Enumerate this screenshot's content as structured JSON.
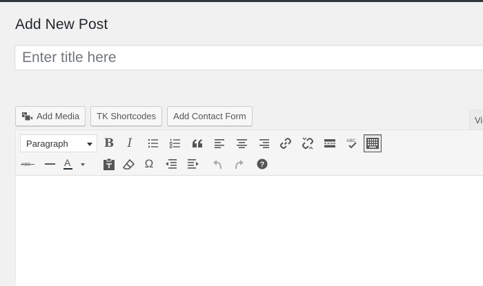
{
  "page": {
    "title": "Add New Post"
  },
  "title_field": {
    "placeholder": "Enter title here",
    "value": ""
  },
  "media_buttons": [
    {
      "label": "Add Media",
      "icon": "add-media-icon"
    },
    {
      "label": "TK Shortcodes"
    },
    {
      "label": "Add Contact Form"
    }
  ],
  "editor_tab": {
    "label": "Vi"
  },
  "toolbar": {
    "format_select": "Paragraph",
    "row1_buttons": [
      "bold",
      "italic",
      "bulleted-list",
      "numbered-list",
      "blockquote",
      "align-left",
      "align-center",
      "align-right",
      "insert-link",
      "remove-link",
      "read-more",
      "proofread",
      "toolbar-toggle"
    ],
    "row2_buttons": [
      "strikethrough",
      "horizontal-line",
      "text-color",
      "paste-as-text",
      "clear-formatting",
      "special-character",
      "decrease-indent",
      "increase-indent",
      "undo",
      "redo",
      "help"
    ],
    "strike_label": "ABC",
    "proof_label": "ABC",
    "omega": "Ω",
    "text_color_letter": "A",
    "bold_letter": "B",
    "italic_letter": "I",
    "help_glyph": "?",
    "colors": {
      "icon": "#555555",
      "active_border": "#555555",
      "text_color_underline": "#23282d"
    }
  },
  "content": {
    "text": ""
  }
}
